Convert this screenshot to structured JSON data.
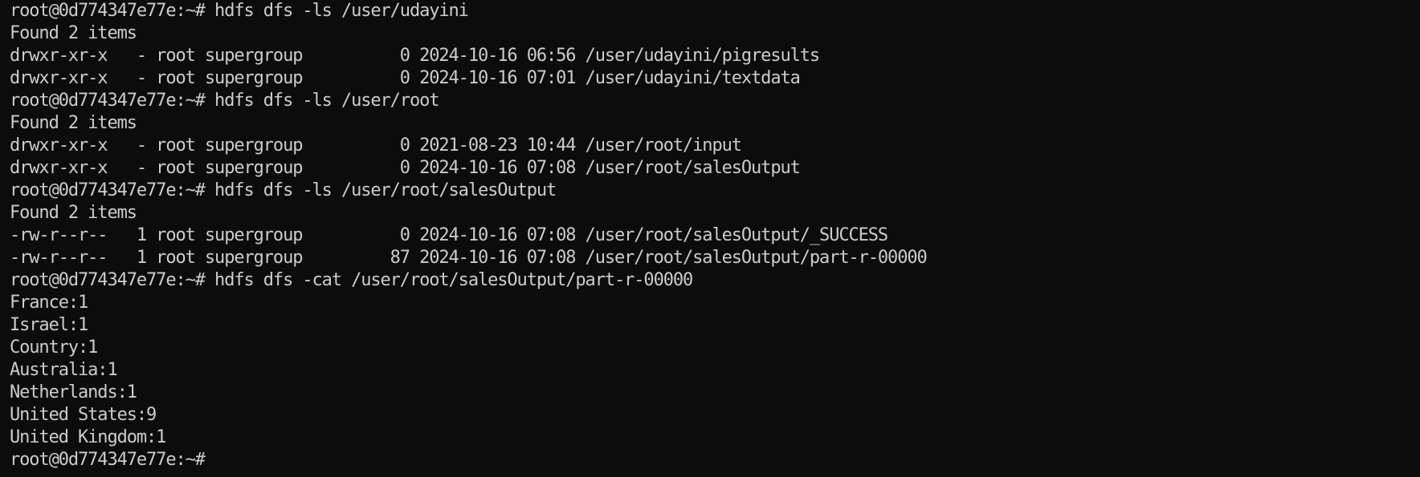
{
  "terminal": {
    "lines": [
      "root@0d774347e77e:~# hdfs dfs -ls /user/udayini",
      "Found 2 items",
      "drwxr-xr-x   - root supergroup          0 2024-10-16 06:56 /user/udayini/pigresults",
      "drwxr-xr-x   - root supergroup          0 2024-10-16 07:01 /user/udayini/textdata",
      "root@0d774347e77e:~# hdfs dfs -ls /user/root",
      "Found 2 items",
      "drwxr-xr-x   - root supergroup          0 2021-08-23 10:44 /user/root/input",
      "drwxr-xr-x   - root supergroup          0 2024-10-16 07:08 /user/root/salesOutput",
      "root@0d774347e77e:~# hdfs dfs -ls /user/root/salesOutput",
      "Found 2 items",
      "-rw-r--r--   1 root supergroup          0 2024-10-16 07:08 /user/root/salesOutput/_SUCCESS",
      "-rw-r--r--   1 root supergroup         87 2024-10-16 07:08 /user/root/salesOutput/part-r-00000",
      "root@0d774347e77e:~# hdfs dfs -cat /user/root/salesOutput/part-r-00000",
      "France:1",
      "Israel:1",
      "Country:1",
      "Australia:1",
      "Netherlands:1",
      "United States:9",
      "United Kingdom:1",
      "root@0d774347e77e:~# "
    ],
    "colors": {
      "background": "#0c0c0c",
      "foreground": "#cccccc"
    }
  }
}
